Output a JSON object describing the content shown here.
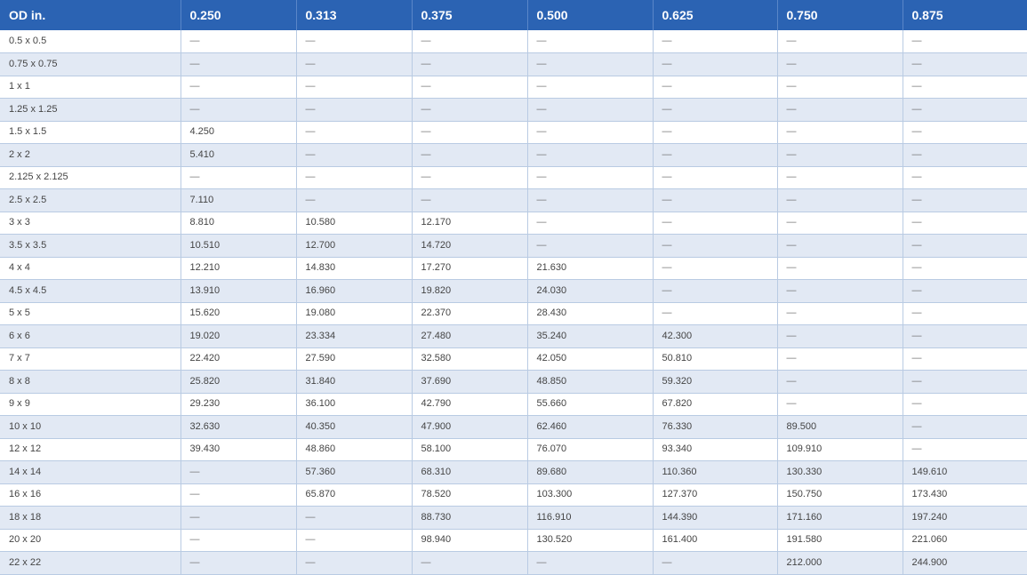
{
  "table": {
    "headers": [
      "OD in.",
      "0.250",
      "0.313",
      "0.375",
      "0.500",
      "0.625",
      "0.750",
      "0.875"
    ],
    "rows": [
      [
        "0.5 x 0.5",
        "—",
        "—",
        "—",
        "—",
        "—",
        "—",
        "—"
      ],
      [
        "0.75 x 0.75",
        "—",
        "—",
        "—",
        "—",
        "—",
        "—",
        "—"
      ],
      [
        "1 x 1",
        "—",
        "—",
        "—",
        "—",
        "—",
        "—",
        "—"
      ],
      [
        "1.25 x 1.25",
        "—",
        "—",
        "—",
        "—",
        "—",
        "—",
        "—"
      ],
      [
        "1.5 x 1.5",
        "4.250",
        "—",
        "—",
        "—",
        "—",
        "—",
        "—"
      ],
      [
        "2 x 2",
        "5.410",
        "—",
        "—",
        "—",
        "—",
        "—",
        "—"
      ],
      [
        "2.125 x 2.125",
        "—",
        "—",
        "—",
        "—",
        "—",
        "—",
        "—"
      ],
      [
        "2.5 x 2.5",
        "7.110",
        "—",
        "—",
        "—",
        "—",
        "—",
        "—"
      ],
      [
        "3 x 3",
        "8.810",
        "10.580",
        "12.170",
        "—",
        "—",
        "—",
        "—"
      ],
      [
        "3.5 x 3.5",
        "10.510",
        "12.700",
        "14.720",
        "—",
        "—",
        "—",
        "—"
      ],
      [
        "4 x 4",
        "12.210",
        "14.830",
        "17.270",
        "21.630",
        "—",
        "—",
        "—"
      ],
      [
        "4.5 x 4.5",
        "13.910",
        "16.960",
        "19.820",
        "24.030",
        "—",
        "—",
        "—"
      ],
      [
        "5 x 5",
        "15.620",
        "19.080",
        "22.370",
        "28.430",
        "—",
        "—",
        "—"
      ],
      [
        "6 x 6",
        "19.020",
        "23.334",
        "27.480",
        "35.240",
        "42.300",
        "—",
        "—"
      ],
      [
        "7 x 7",
        "22.420",
        "27.590",
        "32.580",
        "42.050",
        "50.810",
        "—",
        "—"
      ],
      [
        "8 x 8",
        "25.820",
        "31.840",
        "37.690",
        "48.850",
        "59.320",
        "—",
        "—"
      ],
      [
        "9 x 9",
        "29.230",
        "36.100",
        "42.790",
        "55.660",
        "67.820",
        "—",
        "—"
      ],
      [
        "10 x 10",
        "32.630",
        "40.350",
        "47.900",
        "62.460",
        "76.330",
        "89.500",
        "—"
      ],
      [
        "12 x 12",
        "39.430",
        "48.860",
        "58.100",
        "76.070",
        "93.340",
        "109.910",
        "—"
      ],
      [
        "14 x 14",
        "—",
        "57.360",
        "68.310",
        "89.680",
        "110.360",
        "130.330",
        "149.610"
      ],
      [
        "16 x 16",
        "—",
        "65.870",
        "78.520",
        "103.300",
        "127.370",
        "150.750",
        "173.430"
      ],
      [
        "18 x 18",
        "—",
        "—",
        "88.730",
        "116.910",
        "144.390",
        "171.160",
        "197.240"
      ],
      [
        "20 x 20",
        "—",
        "—",
        "98.940",
        "130.520",
        "161.400",
        "191.580",
        "221.060"
      ],
      [
        "22 x 22",
        "—",
        "—",
        "—",
        "—",
        "—",
        "212.000",
        "244.900"
      ]
    ]
  }
}
